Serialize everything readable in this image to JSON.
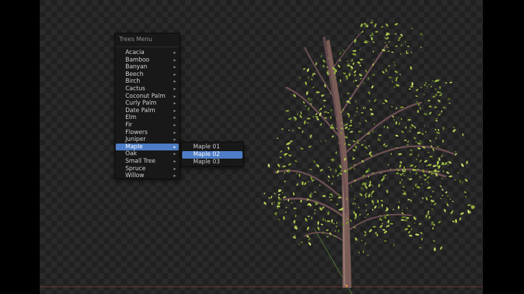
{
  "app": "blender-3d-viewport",
  "menu": {
    "title": "Trees Menu",
    "highlighted": "Maple",
    "highlight_color": "#4d7dc6",
    "submenu_arrow": "▸",
    "items": [
      {
        "label": "Acacia"
      },
      {
        "label": "Bamboo"
      },
      {
        "label": "Banyan"
      },
      {
        "label": "Beech"
      },
      {
        "label": "Birch"
      },
      {
        "label": "Cactus"
      },
      {
        "label": "Coconut Palm"
      },
      {
        "label": "Curly Palm"
      },
      {
        "label": "Date Palm"
      },
      {
        "label": "Elm"
      },
      {
        "label": "Fir"
      },
      {
        "label": "Flowers"
      },
      {
        "label": "Juniper"
      },
      {
        "label": "Maple"
      },
      {
        "label": "Oak"
      },
      {
        "label": "Small Tree"
      },
      {
        "label": "Spruce"
      },
      {
        "label": "Willow"
      }
    ]
  },
  "submenu": {
    "highlighted": "Maple 02",
    "items": [
      {
        "label": "Maple 01"
      },
      {
        "label": "Maple 02"
      },
      {
        "label": "Maple 03"
      }
    ]
  },
  "viewport": {
    "checker_light": "#2a2a2a",
    "checker_dark": "#202020",
    "axis_x_color": "#6b3434",
    "axis_y_color": "#557f35",
    "origin_dot_color": "#e5913e"
  },
  "tree": {
    "name": "maple-tree",
    "leaf_colors": [
      "#cfe26e",
      "#b4d054",
      "#9ab93f",
      "#7e9c33",
      "#64812a",
      "#4c651f"
    ],
    "leaf_weights": [
      0.1,
      0.24,
      0.27,
      0.2,
      0.13,
      0.06
    ],
    "trunk_color": "#7b5d58",
    "trunk_highlight": "#9d8578",
    "branch_color": "#6d4f53"
  }
}
